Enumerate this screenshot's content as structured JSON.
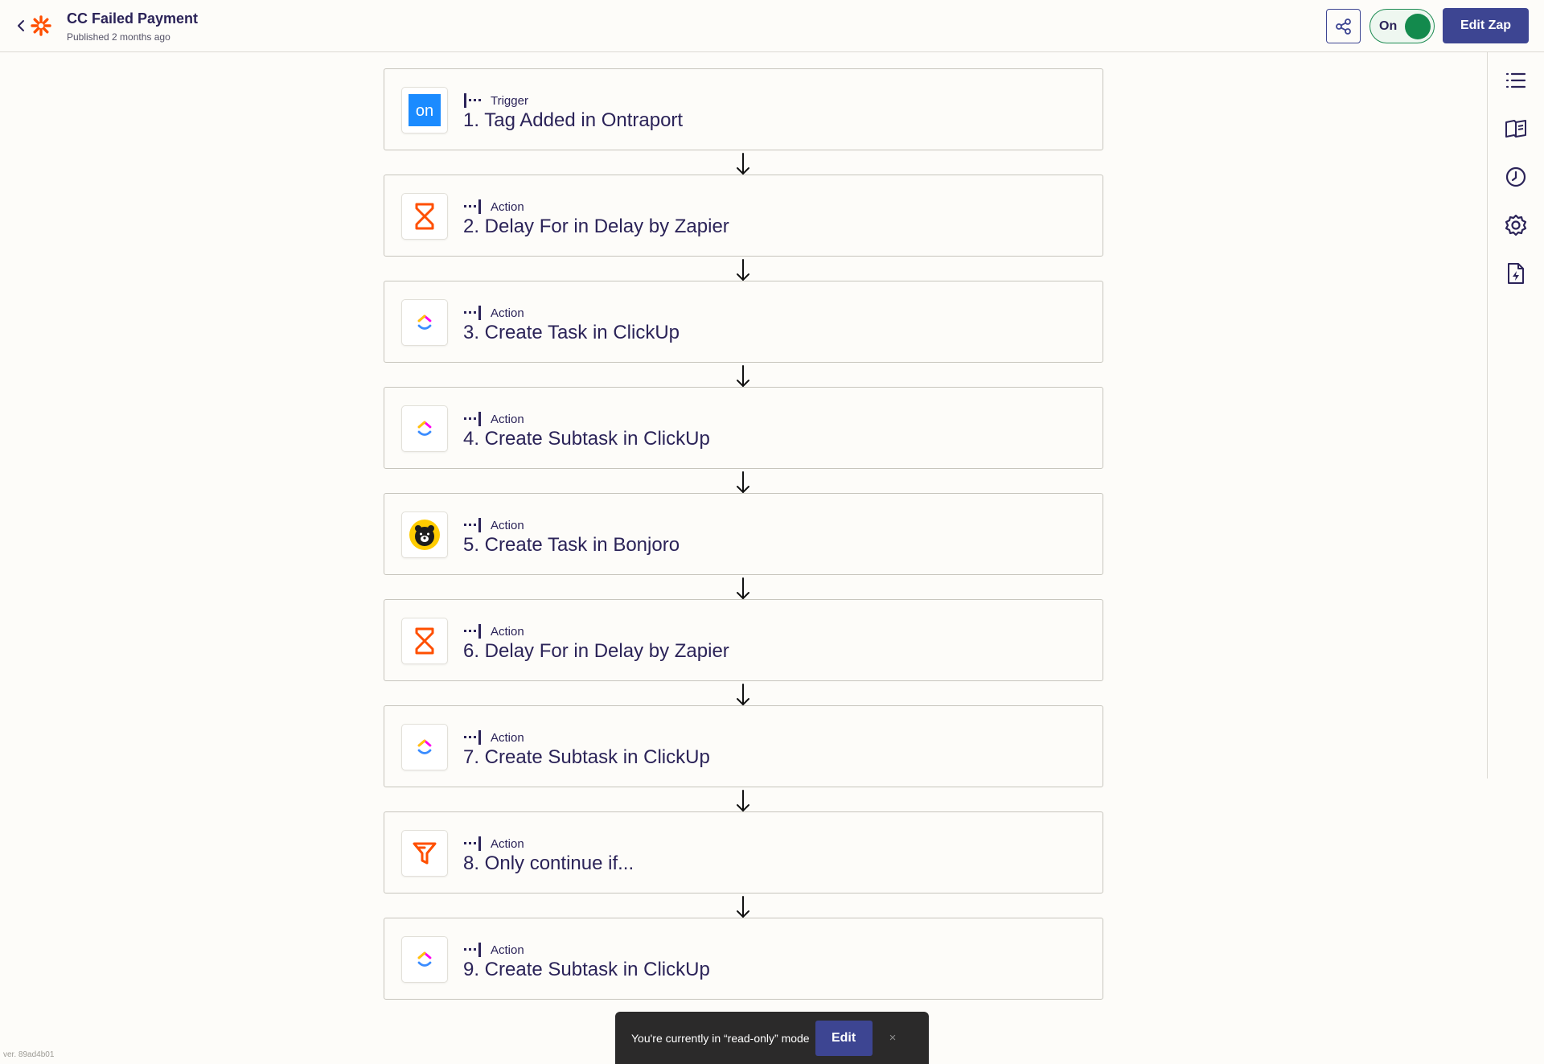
{
  "header": {
    "title": "CC Failed Payment",
    "subtitle": "Published 2 months ago",
    "toggle_label": "On",
    "edit_button": "Edit Zap"
  },
  "steps": [
    {
      "type": "Trigger",
      "title": "1. Tag Added in Ontraport",
      "icon": "ontraport-icon"
    },
    {
      "type": "Action",
      "title": "2. Delay For in Delay by Zapier",
      "icon": "delay-icon"
    },
    {
      "type": "Action",
      "title": "3. Create Task in ClickUp",
      "icon": "clickup-icon"
    },
    {
      "type": "Action",
      "title": "4. Create Subtask in ClickUp",
      "icon": "clickup-icon"
    },
    {
      "type": "Action",
      "title": "5. Create Task in Bonjoro",
      "icon": "bonjoro-icon"
    },
    {
      "type": "Action",
      "title": "6. Delay For in Delay by Zapier",
      "icon": "delay-icon"
    },
    {
      "type": "Action",
      "title": "7. Create Subtask in ClickUp",
      "icon": "clickup-icon"
    },
    {
      "type": "Action",
      "title": "8. Only continue if...",
      "icon": "filter-icon"
    },
    {
      "type": "Action",
      "title": "9. Create Subtask in ClickUp",
      "icon": "clickup-icon"
    }
  ],
  "ontraport_logo_text": "on",
  "footer": {
    "readonly_text": "You're currently in “read-only” mode",
    "edit_button": "Edit",
    "close": "×",
    "version": "ver. 89ad4b01"
  },
  "colors": {
    "brand_orange": "#ff4f00",
    "primary_button": "#3d4592",
    "toggle_on": "#138a4d",
    "text": "#2b2358"
  }
}
